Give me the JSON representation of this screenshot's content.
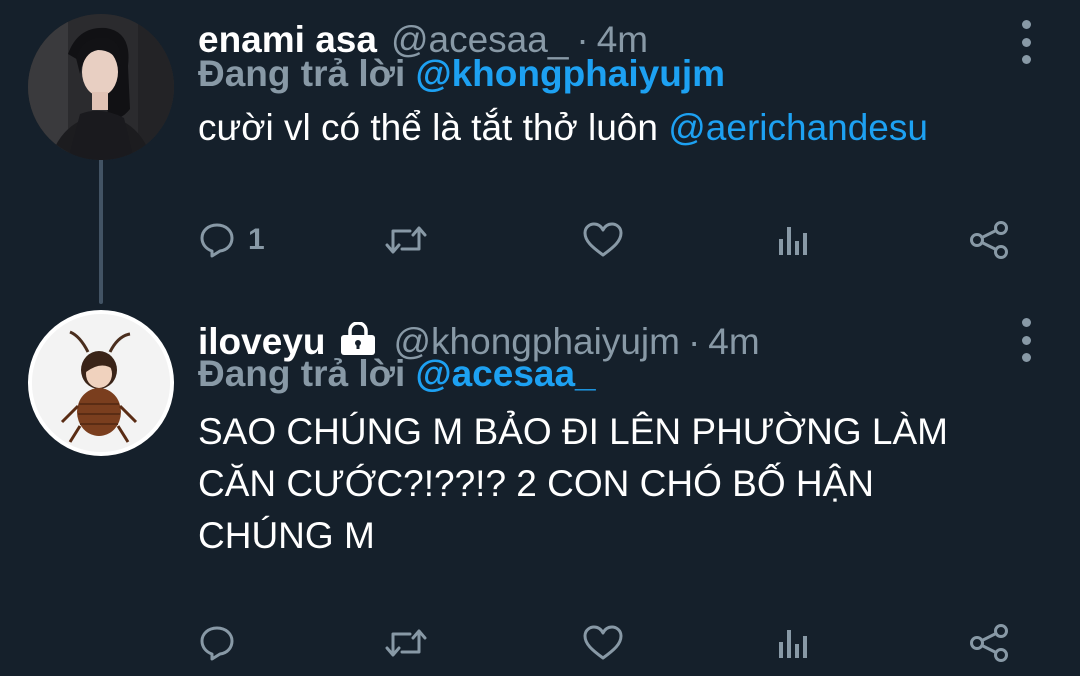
{
  "tweets": [
    {
      "name": "enami asa",
      "handle": "@acesaa_",
      "separator": "·",
      "time": "4m",
      "reply_prefix": "Đang trả lời",
      "reply_to": "@khongphaiyujm",
      "text_plain": "cười vl có thể là tắt thở luôn",
      "text_mention": "@aerichandesu",
      "reply_count": "1",
      "protected": false
    },
    {
      "name": "iloveyu",
      "handle": "@khongphaiyujm",
      "separator": "·",
      "time": "4m",
      "reply_prefix": "Đang trả lời",
      "reply_to": "@acesaa_",
      "text_line1": "SAO CHÚNG M BẢO ĐI LÊN PHƯỜNG LÀM",
      "text_line2": "CĂN CƯỚC?!??!? 2 CON CHÓ BỐ HẬN",
      "text_line3": "CHÚNG M",
      "reply_count": "",
      "protected": true
    }
  ],
  "icons": {
    "reply": "reply-icon",
    "retweet": "retweet-icon",
    "like": "heart-icon",
    "stats": "analytics-icon",
    "share": "share-icon",
    "more": "more-vertical-icon",
    "lock": "lock-icon"
  },
  "colors": {
    "background": "#15202b",
    "text": "#ffffff",
    "secondary": "#8899a6",
    "accent": "#1da1f2",
    "thread_line": "#425364"
  }
}
